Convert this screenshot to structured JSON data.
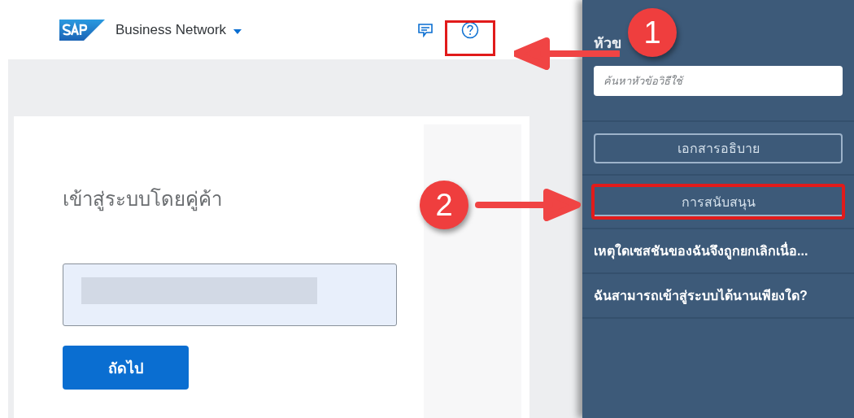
{
  "header": {
    "brand": "Business Network"
  },
  "login": {
    "title": "เข้าสู่ระบบโดยคู่ค้า",
    "button": "ถัดไป"
  },
  "help_panel": {
    "title": "หัวข",
    "search": {
      "placeholder": "ค้นหาหัวข้อวิธีใช้"
    },
    "buttons": [
      {
        "label": "เอกสารอธิบาย",
        "highlighted": false
      },
      {
        "label": "การสนับสนุน",
        "highlighted": true
      }
    ],
    "links": [
      "เหตุใดเซสชันของฉันจึงถูกยกเลิกเนื่อ...",
      "ฉันสามารถเข้าสู่ระบบได้นานเพียงใด?"
    ]
  },
  "annotations": [
    {
      "number": "1"
    },
    {
      "number": "2"
    }
  ]
}
